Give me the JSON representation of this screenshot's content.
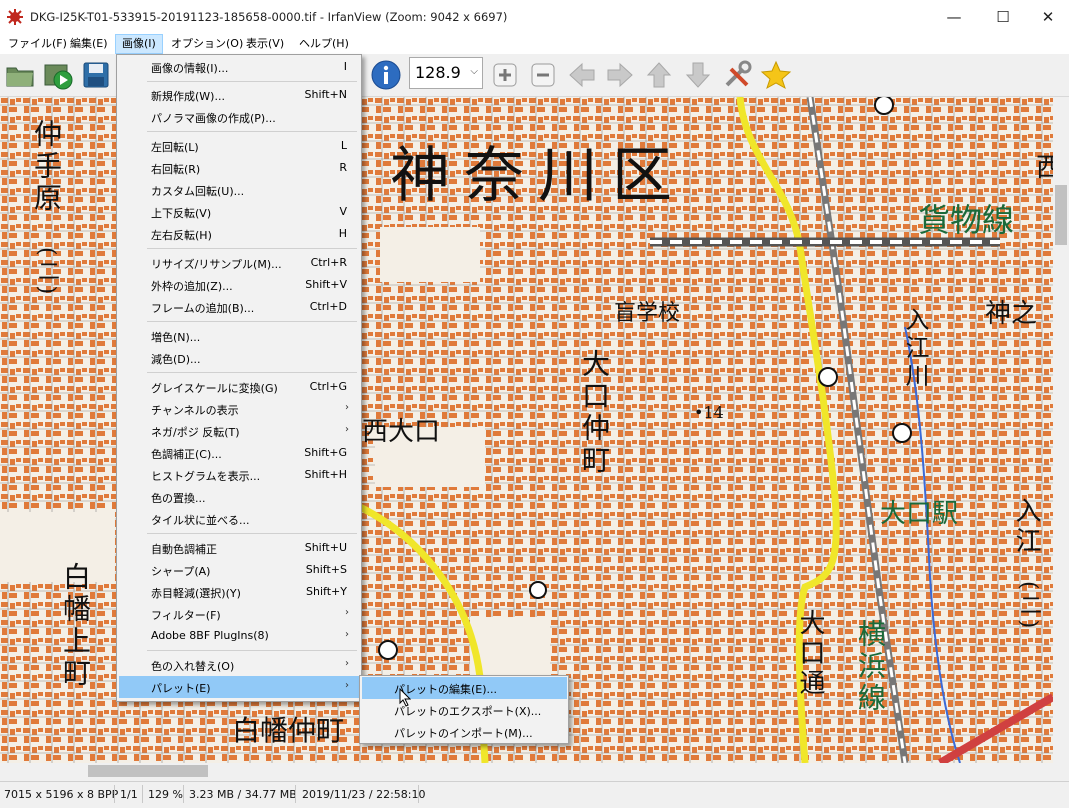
{
  "window": {
    "title": "DKG-I25K-T01-533915-20191123-185658-0000.tif - IrfanView (Zoom: 9042 x 6697)",
    "minimize_glyph": "—",
    "maximize_glyph": "☐",
    "close_glyph": "✕"
  },
  "menubar": [
    "ファイル(F)",
    "編集(E)",
    "画像(I)",
    "オプション(O)",
    "表示(V)",
    "ヘルプ(H)"
  ],
  "toolbar": {
    "zoom_value": "128.9",
    "icons": [
      "open-folder-icon",
      "slideshow-icon",
      "save-icon",
      "info-icon",
      "zoom-in-icon",
      "zoom-out-icon",
      "prev-icon",
      "next-icon",
      "up-icon",
      "down-icon",
      "tools-icon",
      "star-icon"
    ]
  },
  "image_menu": [
    {
      "label": "画像の情報(I)...",
      "shortcut": "I"
    },
    {
      "label": "新規作成(W)...",
      "shortcut": "Shift+N"
    },
    {
      "label": "パノラマ画像の作成(P)...",
      "shortcut": ""
    },
    {
      "label": "左回転(L)",
      "shortcut": "L"
    },
    {
      "label": "右回転(R)",
      "shortcut": "R"
    },
    {
      "label": "カスタム回転(U)...",
      "shortcut": ""
    },
    {
      "label": "上下反転(V)",
      "shortcut": "V"
    },
    {
      "label": "左右反転(H)",
      "shortcut": "H"
    },
    {
      "label": "リサイズ/リサンプル(M)...",
      "shortcut": "Ctrl+R"
    },
    {
      "label": "外枠の追加(Z)...",
      "shortcut": "Shift+V"
    },
    {
      "label": "フレームの追加(B)...",
      "shortcut": "Ctrl+D"
    },
    {
      "label": "増色(N)...",
      "shortcut": ""
    },
    {
      "label": "減色(D)...",
      "shortcut": ""
    },
    {
      "label": "グレイスケールに変換(G)",
      "shortcut": "Ctrl+G"
    },
    {
      "label": "チャンネルの表示",
      "shortcut": ""
    },
    {
      "label": "ネガ/ポジ 反転(T)",
      "shortcut": ""
    },
    {
      "label": "色調補正(C)...",
      "shortcut": "Shift+G"
    },
    {
      "label": "ヒストグラムを表示...",
      "shortcut": "Shift+H"
    },
    {
      "label": "色の置換...",
      "shortcut": ""
    },
    {
      "label": "タイル状に並べる...",
      "shortcut": ""
    },
    {
      "label": "自動色調補正",
      "shortcut": "Shift+U"
    },
    {
      "label": "シャープ(A)",
      "shortcut": "Shift+S"
    },
    {
      "label": "赤目軽減(選択)(Y)",
      "shortcut": "Shift+Y"
    },
    {
      "label": "フィルター(F)",
      "shortcut": ""
    },
    {
      "label": "Adobe 8BF PlugIns(8)",
      "shortcut": ""
    },
    {
      "label": "色の入れ替え(O)",
      "shortcut": ""
    },
    {
      "label": "パレット(E)",
      "shortcut": ""
    }
  ],
  "submenu_arrow": "›",
  "palette_submenu": [
    "パレットの編集(E)...",
    "パレットのエクスポート(X)...",
    "パレットのインポート(M)..."
  ],
  "map_labels": {
    "ward": "神奈川区",
    "kamotsu": "貨物線",
    "nakate": "仲手原",
    "nakate_num": "(二)",
    "shiraha_kami": "白幡上町",
    "shiraha_naka": "白幡仲町",
    "nishi_oguchi": "西大口",
    "oguchi_naka": "大口仲町",
    "mogakko": "盲学校",
    "elev": "•14",
    "oguchi_station": "大口駅",
    "oguchi_dori": "大口通",
    "yokohama_line": "横浜線",
    "kaminoki": "神之",
    "irie": "入江",
    "irie_num": "(二)",
    "irie_gawa": "入江川",
    "nishi_edge": "西"
  },
  "status": [
    "7015 x 5196 x 8 BPP",
    "1/1",
    "129 %",
    "3.23 MB / 34.77 MB",
    "2019/11/23 / 22:58:10"
  ]
}
